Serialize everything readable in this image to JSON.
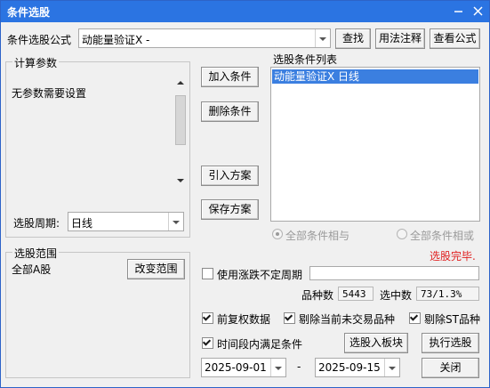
{
  "window": {
    "title": "条件选股"
  },
  "formula": {
    "label": "条件选股公式",
    "value": "动能量验证X  -",
    "search_button": "查找",
    "usage_button": "用法注释",
    "view_button": "查看公式"
  },
  "params": {
    "group_label": "计算参数",
    "message": "无参数需要设置",
    "period_label": "选股周期:",
    "period_value": "日线"
  },
  "actions": {
    "add": "加入条件",
    "delete": "删除条件",
    "import": "引入方案",
    "save": "保存方案"
  },
  "condition_list": {
    "label": "选股条件列表",
    "items": [
      {
        "text": "动能量验证X  日线",
        "selected": true
      }
    ]
  },
  "logic": {
    "all_and": "全部条件相与",
    "all_or": "全部条件相或"
  },
  "status": {
    "text": "选股完毕.",
    "color": "#e01f1f"
  },
  "scope": {
    "group_label": "选股范围",
    "value": "全部A股",
    "change_button": "改变范围"
  },
  "options": {
    "use_change_period": {
      "label": "使用涨跌不定周期",
      "checked": false
    },
    "pre_adjust": {
      "label": "前复权数据",
      "checked": true
    },
    "exclude_untraded": {
      "label": "剔除当前未交易品种",
      "checked": true
    },
    "exclude_st": {
      "label": "剔除ST品种",
      "checked": true
    },
    "time_range": {
      "label": "时间段内满足条件",
      "checked": true
    }
  },
  "stats": {
    "count_label": "品种数",
    "count_value": "5443",
    "selected_label": "选中数",
    "selected_value": "73/1.3%"
  },
  "dates": {
    "start": "2025-09-01",
    "separator": "-",
    "end": "2025-09-15"
  },
  "buttons": {
    "to_block": "选股入板块",
    "execute": "执行选股",
    "close": "关闭"
  },
  "colors": {
    "titlebar": "#2b74e2",
    "selection": "#3b7fe0"
  }
}
